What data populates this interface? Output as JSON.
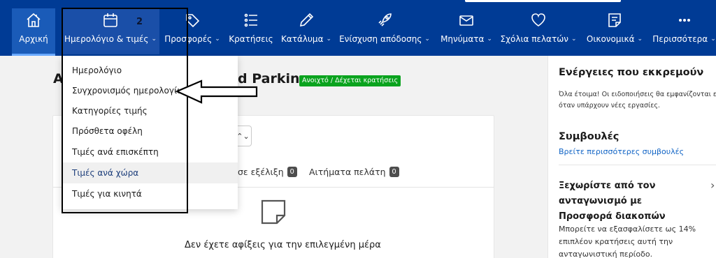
{
  "nav": {
    "home": "Αρχική",
    "calendar": "Ημερολόγιο & τιμές",
    "offers": "Προσφορές",
    "reservations": "Κρατήσεις",
    "property": "Κατάλυμα",
    "boost": "Ενίσχυση απόδοσης",
    "messages": "Μηνύματα",
    "reviews": "Σχόλια πελατών",
    "finance": "Οικονομικά",
    "more": "Περισσότερα"
  },
  "annotation": {
    "number": "2"
  },
  "dropdown": {
    "items": [
      "Ημερολόγιο",
      "Συγχρονισμός ημερολογίων",
      "Κατηγορίες τιμής",
      "Πρόσθετα οφέλη",
      "Τιμές ανά επισκέπτη",
      "Τιμές ανά χώρα",
      "Τιμές για κινητά"
    ]
  },
  "main": {
    "title_start": "A",
    "title_end": "d Parking",
    "status": "Ανοιχτό / Δέχεται κρατήσεις",
    "select_icon": "⌃⌄",
    "tabs": [
      {
        "label": "σε εξέλιξη",
        "count": "0"
      },
      {
        "label": "Αιτήματα πελάτη",
        "count": "0"
      }
    ],
    "empty_text": "Δεν έχετε αφίξεις για την επιλεγμένη μέρα"
  },
  "sidebar": {
    "pending_title": "Ενέργειες που εκκρεμούν",
    "pending_text": "Όλα έτοιμα! Οι ειδοποιήσεις θα εμφανίζονται εδώ όταν υπάρχουν νέες εργασίες.",
    "tips_title": "Συμβουλές",
    "tips_link": "Βρείτε περισσότερες συμβουλές",
    "promo_title": "Ξεχωρίστε από τον ανταγωνισμό με Προσφορά διακοπών",
    "promo_text": "Μπορείτε να εξασφαλίσετε ως 14% επιπλέον κρατήσεις αυτή την ανταγωνιστική περίοδο."
  },
  "colors": {
    "nav_bg": "#003b95",
    "status_green": "#0aa31e",
    "link_blue": "#0f63c5"
  }
}
